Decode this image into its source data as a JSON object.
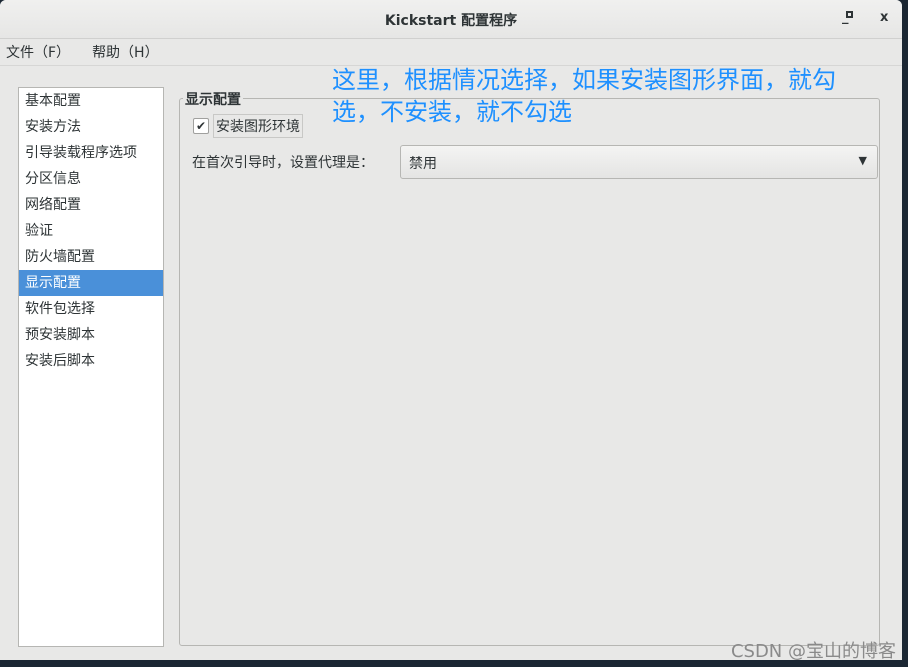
{
  "window": {
    "title": "Kickstart 配置程序",
    "minimize": "_",
    "maximize": "▫",
    "close": "x"
  },
  "menu": [
    "文件（F）",
    "帮助（H）"
  ],
  "sidebar": {
    "items": [
      "基本配置",
      "安装方法",
      "引导装载程序选项",
      "分区信息",
      "网络配置",
      "验证",
      "防火墙配置",
      "显示配置",
      "软件包选择",
      "预安装脚本",
      "安装后脚本"
    ],
    "selected": 7
  },
  "display": {
    "section_title": "显示配置",
    "install_gui_label": "安装图形环境",
    "install_gui_checked": true,
    "proxy_label": "在首次引导时，设置代理是：",
    "proxy_value": "禁用"
  },
  "annotation": "这里，根据情况选择，如果安装图形界面，就勾选，不安装，就不勾选",
  "watermark": "CSDN @宝山的博客",
  "colors": {
    "selection": "#4a90d9",
    "annotation": "#1e90ff"
  }
}
